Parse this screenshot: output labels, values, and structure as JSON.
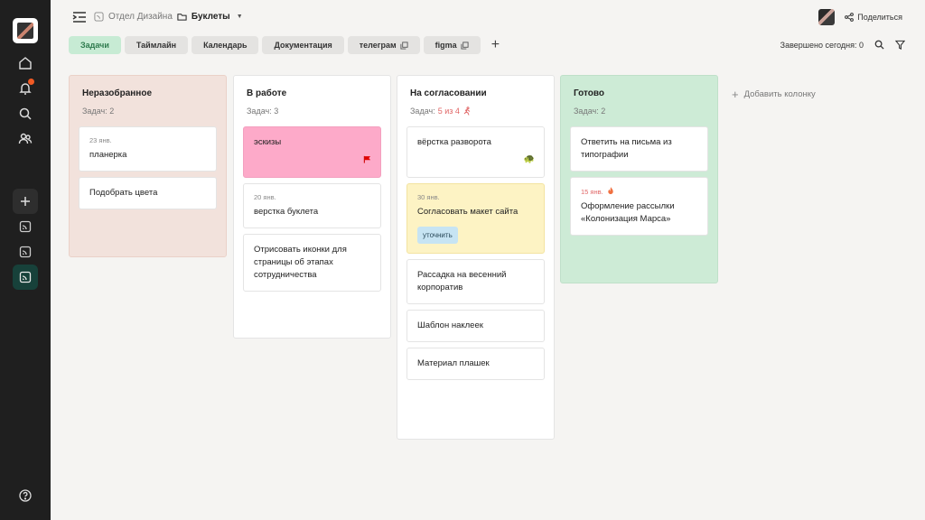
{
  "colors": {
    "sidebar_bg": "#1f1f1f",
    "accent_green": "#2f7b4e",
    "notification": "#f15a24"
  },
  "sidebar": {
    "items": [
      {
        "name": "logo"
      },
      {
        "name": "home-icon"
      },
      {
        "name": "bell-icon",
        "has_notification": true
      },
      {
        "name": "search-icon"
      },
      {
        "name": "users-icon"
      },
      {
        "name": "plus-icon"
      },
      {
        "name": "board-icon"
      },
      {
        "name": "board-icon"
      },
      {
        "name": "board-icon",
        "active": true
      },
      {
        "name": "help-icon"
      }
    ]
  },
  "header": {
    "breadcrumb": {
      "parent": "Отдел Дизайна",
      "current": "Буклеты"
    },
    "share_label": "Поделиться"
  },
  "tabs": [
    {
      "label": "Задачи",
      "active": true
    },
    {
      "label": "Таймлайн"
    },
    {
      "label": "Календарь"
    },
    {
      "label": "Документация"
    },
    {
      "label": "телеграм",
      "external": true
    },
    {
      "label": "figma",
      "external": true
    }
  ],
  "toolbar": {
    "completed_today": "Завершено сегодня: 0"
  },
  "add_column_label": "Добавить колонку",
  "columns": [
    {
      "title": "Неразобранное",
      "count_text": "Задач: 2",
      "bg": "#f2e2dc",
      "cards": [
        {
          "date": "23 янв.",
          "title": "планерка"
        },
        {
          "title": "Подобрать цвета"
        }
      ]
    },
    {
      "title": "В работе",
      "count_text": "Задач: 3",
      "bg": "#ffffff",
      "cards": [
        {
          "title": "эскизы",
          "bg": "#fdaac9",
          "flag": true
        },
        {
          "date": "20 янв.",
          "title": "верстка буклета"
        },
        {
          "title": "Отрисовать иконки для страницы об этапах сотрудничества"
        }
      ]
    },
    {
      "title": "На согласовании",
      "count_text": "Задач:",
      "count_warn": "5 из 4",
      "bg": "#ffffff",
      "cards": [
        {
          "title": "вёрстка разворота",
          "turtle": true
        },
        {
          "date": "30 янв.",
          "title": "Согласовать макет сайта",
          "bg": "#fdf3c4",
          "tag": "уточнить"
        },
        {
          "title": "Рассадка на весенний корпоратив"
        },
        {
          "title": "Шаблон наклеек"
        },
        {
          "title": "Материал плашек"
        }
      ]
    },
    {
      "title": "Готово",
      "count_text": "Задач: 2",
      "bg": "#cdebd6",
      "cards": [
        {
          "title": "Ответить на письма из типографии"
        },
        {
          "date": "15 янв.",
          "date_overdue": true,
          "title": "Оформление рассылки «Колонизация Марса»"
        }
      ]
    }
  ]
}
